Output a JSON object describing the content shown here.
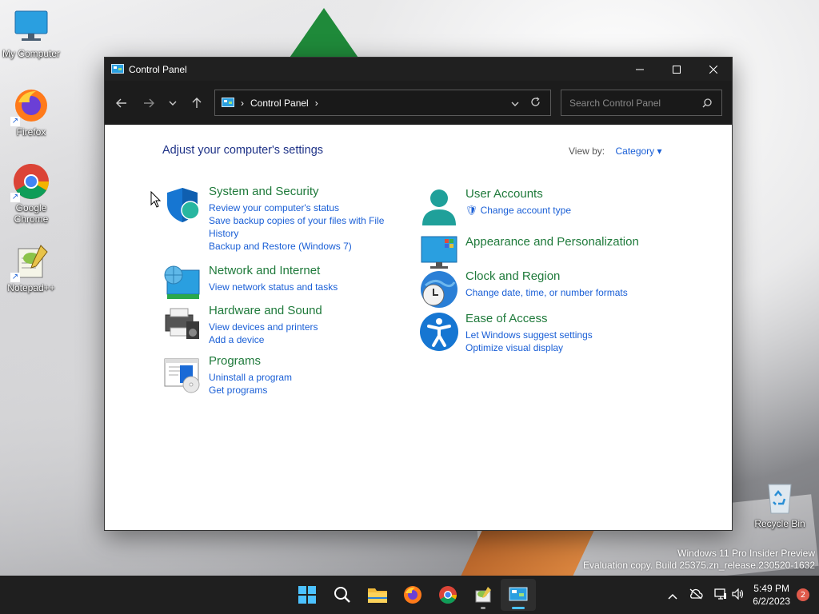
{
  "desktop": {
    "icons": [
      {
        "label": "My Computer"
      },
      {
        "label": "Firefox"
      },
      {
        "label": "Google Chrome"
      },
      {
        "label": "Notepad++"
      },
      {
        "label": "Recycle Bin"
      }
    ],
    "watermark_line1": "Windows 11 Pro Insider Preview",
    "watermark_line2": "Evaluation copy. Build 25375.zn_release.230520-1632"
  },
  "window": {
    "title": "Control Panel",
    "breadcrumb": "Control Panel",
    "search_placeholder": "Search Control Panel",
    "heading": "Adjust your computer's settings",
    "view_by_label": "View by:",
    "view_by_value": "Category"
  },
  "categories": {
    "system": {
      "title": "System and Security",
      "links": [
        "Review your computer's status",
        "Save backup copies of your files with File History",
        "Backup and Restore (Windows 7)"
      ]
    },
    "network": {
      "title": "Network and Internet",
      "links": [
        "View network status and tasks"
      ]
    },
    "hardware": {
      "title": "Hardware and Sound",
      "links": [
        "View devices and printers",
        "Add a device"
      ]
    },
    "programs": {
      "title": "Programs",
      "links": [
        "Uninstall a program",
        "Get programs"
      ]
    },
    "users": {
      "title": "User Accounts",
      "links": [
        "Change account type"
      ]
    },
    "appearance": {
      "title": "Appearance and Personalization",
      "links": []
    },
    "clock": {
      "title": "Clock and Region",
      "links": [
        "Change date, time, or number formats"
      ]
    },
    "ease": {
      "title": "Ease of Access",
      "links": [
        "Let Windows suggest settings",
        "Optimize visual display"
      ]
    }
  },
  "taskbar": {
    "time": "5:49 PM",
    "date": "6/2/2023",
    "notification_count": "2",
    "apps": [
      "start-icon",
      "search-icon",
      "file-explorer-icon",
      "firefox-icon",
      "chrome-icon",
      "notepad-plus-plus-icon",
      "control-panel-icon"
    ]
  },
  "colors": {
    "link": "#1a5fd6",
    "category_title": "#1f7a3b",
    "heading": "#1e3287",
    "taskbar": "#1f1f1f",
    "accent": "#4cc2ff"
  }
}
